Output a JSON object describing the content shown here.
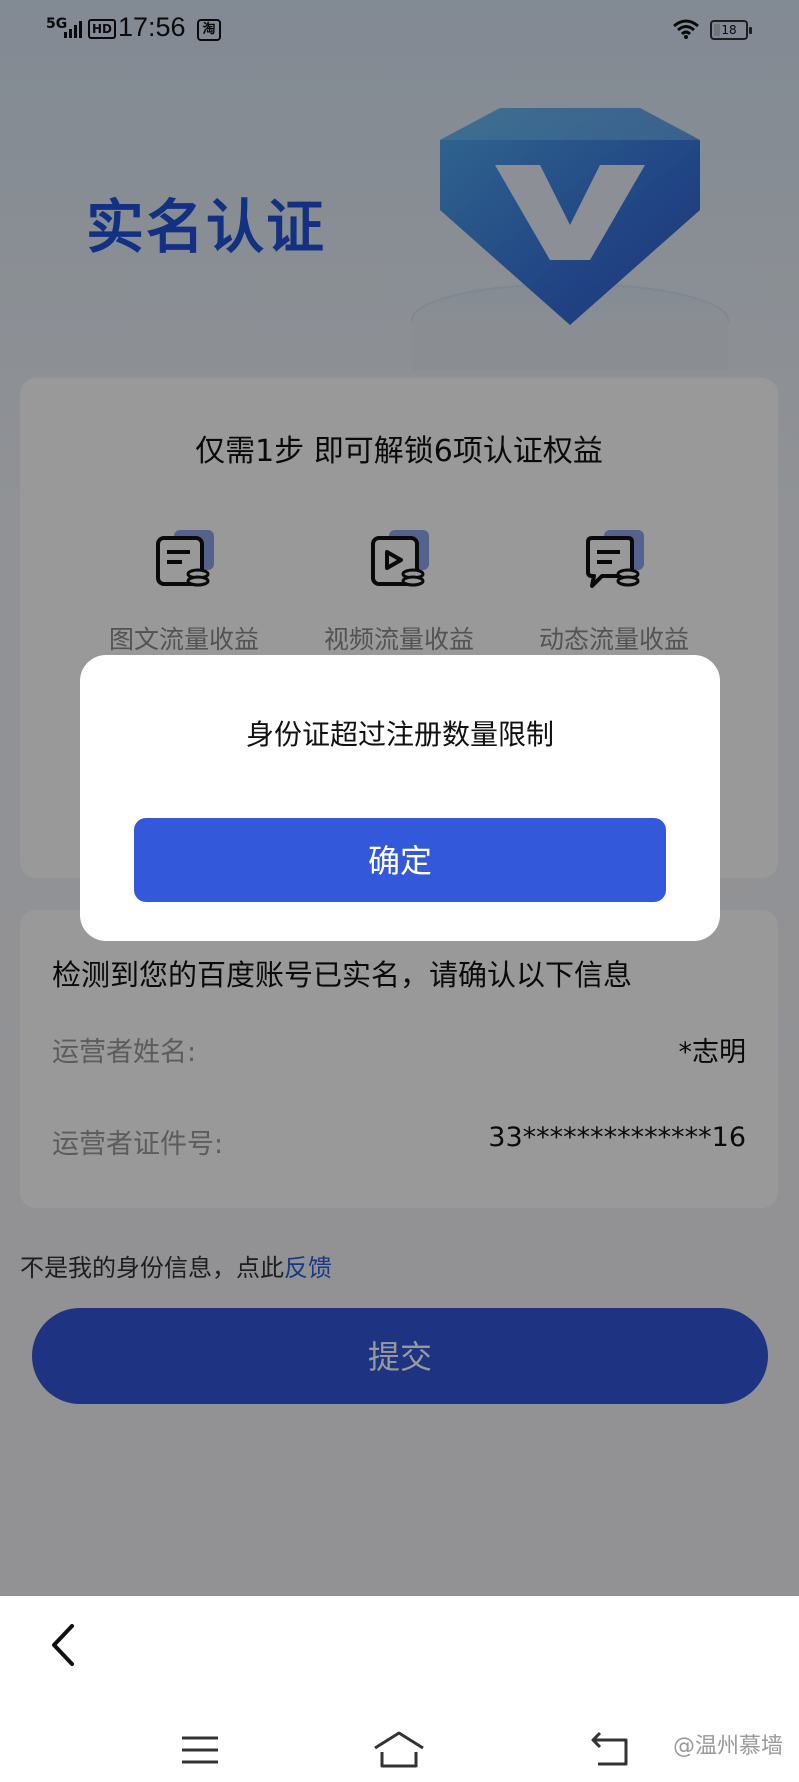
{
  "status_bar": {
    "signal": "5G",
    "hd": "HD",
    "time": "17:56",
    "app_badge": "淘",
    "battery": "18"
  },
  "header": {
    "title": "实名认证"
  },
  "benefits_card": {
    "tagline": "仅需1步 即可解锁6项认证权益",
    "items": [
      {
        "label": "图文流量收益",
        "icon": "article-coin-icon"
      },
      {
        "label": "视频流量收益",
        "icon": "video-coin-icon"
      },
      {
        "label": "动态流量收益",
        "icon": "chat-coin-icon"
      }
    ]
  },
  "info_card": {
    "heading": "检测到您的百度账号已实名，请确认以下信息",
    "rows": [
      {
        "label": "运营者姓名:",
        "value": "*志明"
      },
      {
        "label": "运营者证件号:",
        "value": "33**************16"
      }
    ]
  },
  "feedback": {
    "text": "不是我的身份信息，点此",
    "link": "反馈"
  },
  "submit_label": "提交",
  "dialog": {
    "message": "身份证超过注册数量限制",
    "confirm_label": "确定"
  },
  "watermark": "@温州慕墙",
  "colors": {
    "accent": "#3356d8",
    "title_blue": "#2153d9",
    "link": "#2b5fd9"
  }
}
